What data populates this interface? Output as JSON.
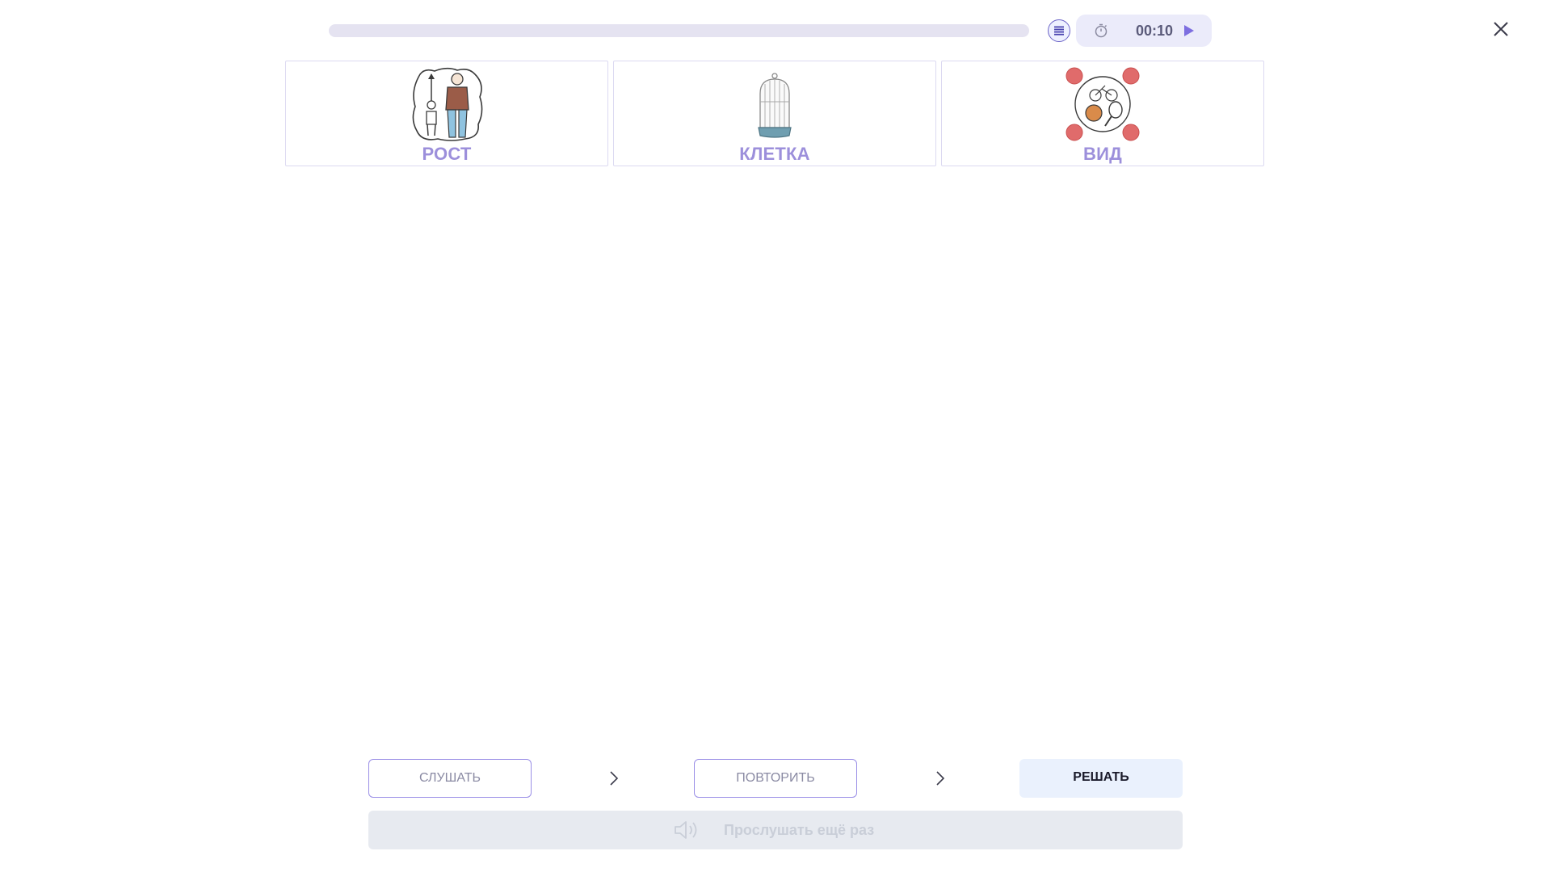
{
  "progress": {
    "fraction": 0
  },
  "timer": {
    "time": "00:10"
  },
  "icons": {
    "list": "list-icon",
    "clock": "stopwatch-icon",
    "play": "play-icon",
    "close": "close-icon",
    "speaker": "speaker-icon"
  },
  "colors": {
    "accent": "#6b63c7",
    "card_label": "#9c8fdb",
    "solve_bg": "#eaf1fd"
  },
  "cards": [
    {
      "label": "РОСТ",
      "picture": "height-growth-picture"
    },
    {
      "label": "КЛЕТКА",
      "picture": "birdcage-picture"
    },
    {
      "label": "ВИД",
      "picture": "sports-kinds-picture"
    }
  ],
  "steps": {
    "listen": "СЛУШАТЬ",
    "repeat": "ПОВТОРИТЬ",
    "solve": "РЕШАТЬ"
  },
  "replay": {
    "label": "Прослушать ещё раз"
  }
}
